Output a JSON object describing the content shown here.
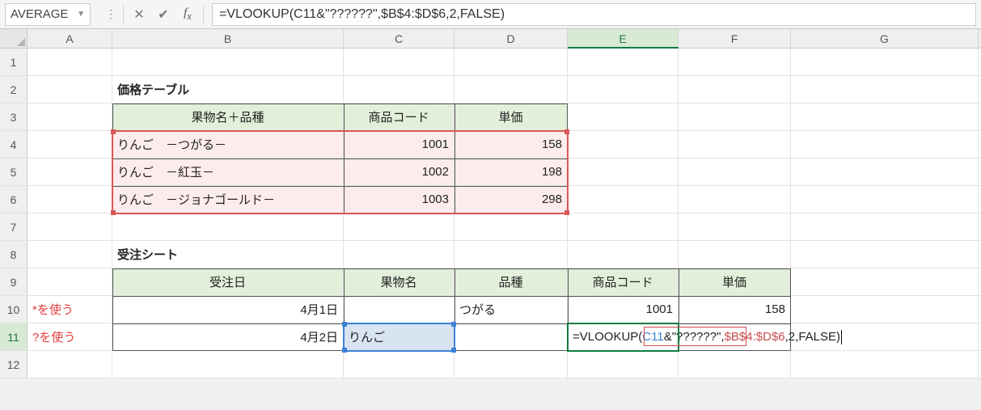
{
  "formula_bar": {
    "name_box": "AVERAGE",
    "formula_text": "=VLOOKUP(C11&\"??????\",$B$4:$D$6,2,FALSE)"
  },
  "columns": [
    "A",
    "B",
    "C",
    "D",
    "E",
    "F",
    "G"
  ],
  "row_numbers": [
    "1",
    "2",
    "3",
    "4",
    "5",
    "6",
    "7",
    "8",
    "9",
    "10",
    "11",
    "12"
  ],
  "labels": {
    "price_table_title": "価格テーブル",
    "price_headers": {
      "name": "果物名＋品種",
      "code": "商品コード",
      "price": "単価"
    },
    "order_title": "受注シート",
    "order_headers": {
      "date": "受注日",
      "fruit": "果物名",
      "variety": "品種",
      "code": "商品コード",
      "price": "単価"
    },
    "note10": "*を使う",
    "note11": "?を使う"
  },
  "price_rows": [
    {
      "name": "りんご　－つがる－",
      "code": "1001",
      "price": "158"
    },
    {
      "name": "りんご　－紅玉－",
      "code": "1002",
      "price": "198"
    },
    {
      "name": "りんご　－ジョナゴールド－",
      "code": "1003",
      "price": "298"
    }
  ],
  "order_rows": [
    {
      "date": "4月1日",
      "fruit": "",
      "variety": "つがる",
      "code": "1001",
      "price": "158"
    },
    {
      "date": "4月2日",
      "fruit": "りんご",
      "variety": "",
      "code": "",
      "price": ""
    }
  ],
  "inline_formula": {
    "prefix": "=VLOOKUP(",
    "ref1": "C11",
    "mid1": "&\"??????\",",
    "ref2": "$B$4:$D$6",
    "suffix": ",2,FALSE)"
  },
  "chart_data": {
    "type": "table",
    "tables": [
      {
        "name": "価格テーブル",
        "columns": [
          "果物名＋品種",
          "商品コード",
          "単価"
        ],
        "rows": [
          [
            "りんご　－つがる－",
            1001,
            158
          ],
          [
            "りんご　－紅玉－",
            1002,
            198
          ],
          [
            "りんご　－ジョナゴールド－",
            1003,
            298
          ]
        ]
      },
      {
        "name": "受注シート",
        "columns": [
          "受注日",
          "果物名",
          "品種",
          "商品コード",
          "単価"
        ],
        "rows": [
          [
            "4月1日",
            "",
            "つがる",
            1001,
            158
          ],
          [
            "4月2日",
            "りんご",
            "",
            "",
            ""
          ]
        ]
      }
    ]
  }
}
